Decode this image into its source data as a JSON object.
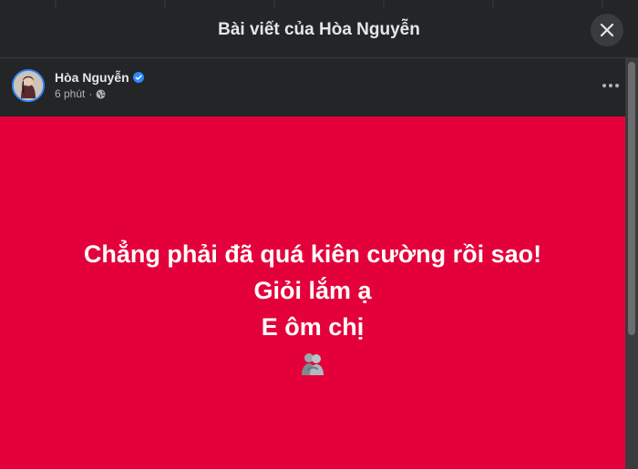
{
  "modal": {
    "title": "Bài viết của Hòa Nguyễn"
  },
  "post": {
    "author": "Hòa Nguyễn",
    "time": "6 phút",
    "separator": "·",
    "lines": [
      "Chẳng phải đã quá kiên cường rồi sao!",
      "Giỏi lắm ạ",
      "E ôm chị"
    ],
    "background_color": "#e4003a",
    "emoji": "people-hugging"
  },
  "icons": {
    "close": "close-icon",
    "verified": "verified-badge-icon",
    "audience": "globe-icon",
    "more": "more-options-icon"
  },
  "colors": {
    "verified": "#2d88ff",
    "surface": "#242526",
    "text": "#e4e6eb"
  }
}
